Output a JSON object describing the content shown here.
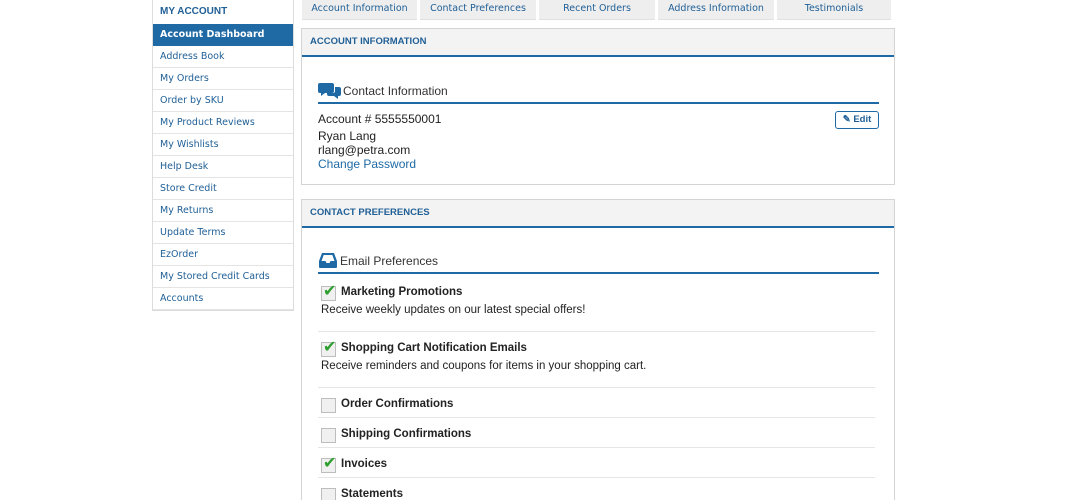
{
  "sidebar": {
    "title": "MY ACCOUNT",
    "items": [
      {
        "label": "Account Dashboard"
      },
      {
        "label": "Address Book"
      },
      {
        "label": "My Orders"
      },
      {
        "label": "Order by SKU"
      },
      {
        "label": "My Product Reviews"
      },
      {
        "label": "My Wishlists"
      },
      {
        "label": "Help Desk"
      },
      {
        "label": "Store Credit"
      },
      {
        "label": "My Returns"
      },
      {
        "label": "Update Terms"
      },
      {
        "label": "EzOrder"
      },
      {
        "label": "My Stored Credit Cards"
      },
      {
        "label": "Accounts"
      }
    ]
  },
  "tabs": [
    {
      "label": "Account Information"
    },
    {
      "label": "Contact Preferences"
    },
    {
      "label": "Recent Orders"
    },
    {
      "label": "Address Information"
    },
    {
      "label": "Testimonials"
    }
  ],
  "account_panel": {
    "header": "ACCOUNT INFORMATION",
    "section_title": "Contact Information",
    "account_number": "Account # 5555550001",
    "name": "Ryan Lang",
    "email": "rlang@petra.com",
    "change_password": "Change Password",
    "edit_label": "Edit"
  },
  "preferences_panel": {
    "header": "CONTACT PREFERENCES",
    "section_title": "Email Preferences",
    "items": [
      {
        "label": "Marketing Promotions",
        "description": "Receive weekly updates on our latest special offers!",
        "checked": true
      },
      {
        "label": "Shopping Cart Notification Emails",
        "description": "Receive reminders and coupons for items in your shopping cart.",
        "checked": true
      },
      {
        "label": "Order Confirmations",
        "description": "",
        "checked": false
      },
      {
        "label": "Shipping Confirmations",
        "description": "",
        "checked": false
      },
      {
        "label": "Invoices",
        "description": "",
        "checked": true
      },
      {
        "label": "Statements",
        "description": "",
        "checked": false
      }
    ]
  },
  "colors": {
    "accent": "#1f6aa5",
    "link": "#1f5f96",
    "check": "#2e9e2e"
  }
}
